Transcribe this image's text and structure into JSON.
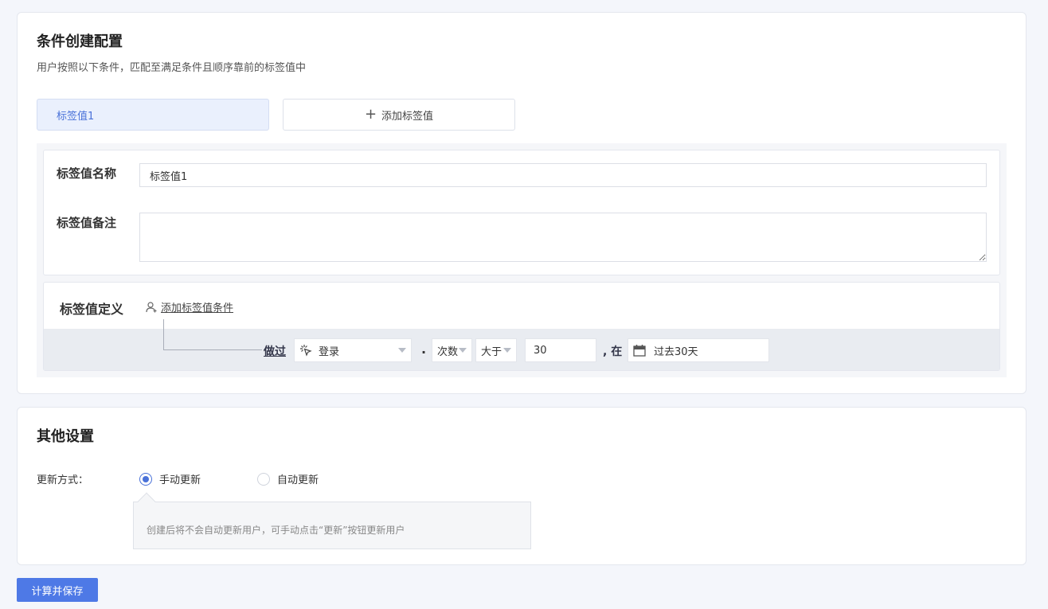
{
  "condition_config": {
    "title": "条件创建配置",
    "subtitle": "用户按照以下条件，匹配至满足条件且顺序靠前的标签值中",
    "tabs": [
      {
        "label": "标签值1"
      }
    ],
    "add_tab_label": "添加标签值",
    "name_label": "标签值名称",
    "name_value": "标签值1",
    "remark_label": "标签值备注",
    "remark_value": "",
    "definition_label": "标签值定义",
    "add_condition_label": "添加标签值条件",
    "condition": {
      "do_label": "做过",
      "event": "登录",
      "separator": ".",
      "metric": "次数",
      "operator": "大于",
      "value": "30",
      "in_label": ", 在",
      "time_range": "过去30天"
    }
  },
  "other_settings": {
    "title": "其他设置",
    "update_label": "更新方式：",
    "options": [
      {
        "label": "手动更新",
        "selected": true
      },
      {
        "label": "自动更新",
        "selected": false
      }
    ],
    "tip": "创建后将不会自动更新用户，可手动点击“更新”按钮更新用户"
  },
  "save_label": "计算并保存",
  "colors": {
    "accent": "#4e79e6",
    "active_tab_bg": "#eaf0fd"
  }
}
